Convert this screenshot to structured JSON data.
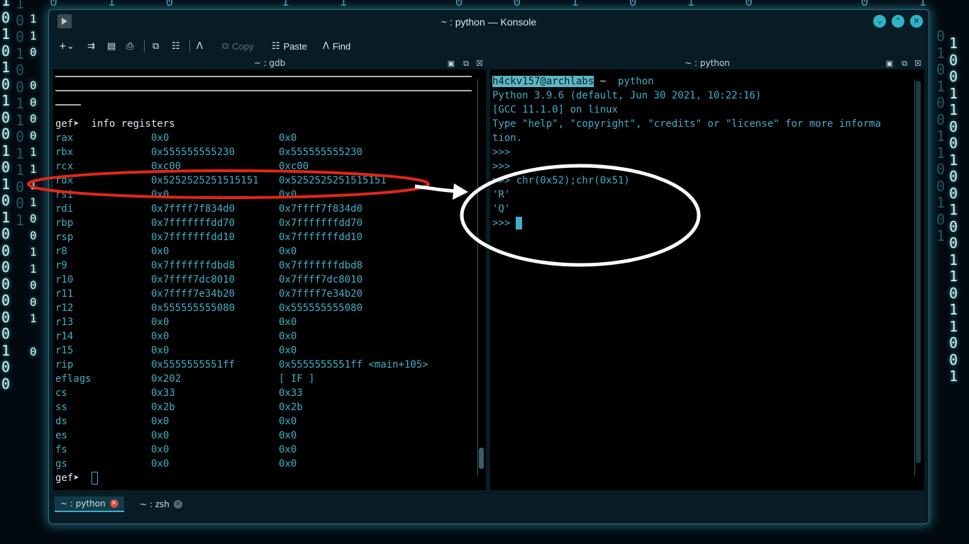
{
  "window": {
    "title": "~ : python — Konsole",
    "buttons": [
      "chevron-down",
      "chevron-up",
      "close"
    ]
  },
  "toolbar": {
    "new_tab_label": "+⌄",
    "copy_label": "Copy",
    "paste_label": "Paste",
    "find_label": "Find"
  },
  "left_pane": {
    "title": "~ : gdb",
    "command": "gef➤  info registers",
    "rows": [
      [
        "rax",
        "0x0",
        "0x0"
      ],
      [
        "rbx",
        "0x555555555230",
        "0x555555555230"
      ],
      [
        "rcx",
        "0xc00",
        "0xc00"
      ],
      [
        "rdx",
        "0x5252525251515151",
        "0x5252525251515151"
      ],
      [
        "rsi",
        "0x0",
        "0x0"
      ],
      [
        "rdi",
        "0x7ffff7f834d0",
        "0x7ffff7f834d0"
      ],
      [
        "rbp",
        "0x7fffffffdd70",
        "0x7fffffffdd70"
      ],
      [
        "rsp",
        "0x7fffffffdd10",
        "0x7fffffffdd10"
      ],
      [
        "r8",
        "0x0",
        "0x0"
      ],
      [
        "r9",
        "0x7fffffffdbd8",
        "0x7fffffffdbd8"
      ],
      [
        "r10",
        "0x7ffff7dc8010",
        "0x7ffff7dc8010"
      ],
      [
        "r11",
        "0x7ffff7e34b20",
        "0x7ffff7e34b20"
      ],
      [
        "r12",
        "0x555555555080",
        "0x555555555080"
      ],
      [
        "r13",
        "0x0",
        "0x0"
      ],
      [
        "r14",
        "0x0",
        "0x0"
      ],
      [
        "r15",
        "0x0",
        "0x0"
      ],
      [
        "rip",
        "0x5555555551ff",
        "0x5555555551ff <main+105>"
      ],
      [
        "eflags",
        "0x202",
        "[ IF ]"
      ],
      [
        "cs",
        "0x33",
        "0x33"
      ],
      [
        "ss",
        "0x2b",
        "0x2b"
      ],
      [
        "ds",
        "0x0",
        "0x0"
      ],
      [
        "es",
        "0x0",
        "0x0"
      ],
      [
        "fs",
        "0x0",
        "0x0"
      ],
      [
        "gs",
        "0x0",
        "0x0"
      ]
    ],
    "prompt": "gef➤"
  },
  "right_pane": {
    "title": "~ : python",
    "user_host": "h4ckv157@archlabs",
    "prompt_sep": " ~ ",
    "cmd": "python",
    "lines": [
      "Python 3.9.6 (default, Jun 30 2021, 10:22:16)",
      "[GCC 11.1.0] on linux",
      "Type \"help\", \"copyright\", \"credits\" or \"license\" for more informa",
      "tion.",
      ">>>",
      ">>>",
      ">>> chr(0x52);chr(0x51)",
      "'R'",
      "'Q'",
      ">>>"
    ]
  },
  "tabs": [
    {
      "label": "~ : python",
      "active": true
    },
    {
      "label": "~ : zsh",
      "active": false
    }
  ],
  "colors": {
    "accent": "#3fb0c8",
    "annotation_red": "#e2261b",
    "annotation_white": "#ffffff"
  }
}
